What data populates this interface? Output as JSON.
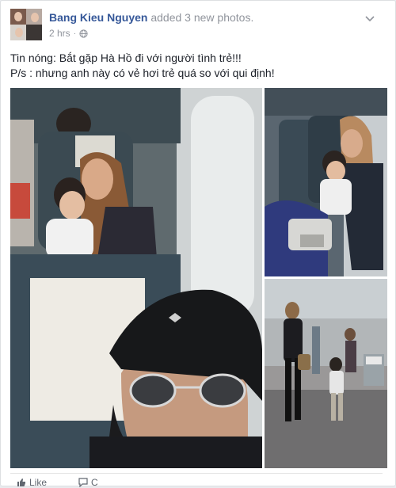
{
  "post": {
    "author": "Bang Kieu Nguyen",
    "action": "added 3 new photos.",
    "timestamp": "2 hrs",
    "separator": "·",
    "privacy_icon": "globe-icon",
    "menu_icon": "chevron-down-icon",
    "text_line1": "Tin nóng: Bắt gặp Hà Hồ đi với người tình trẻ!!!",
    "text_line2": "P/s : nhưng anh này có vẻ hơi trẻ quá so với qui định!"
  },
  "photos": [
    {
      "name": "photo-selfie-airplane"
    },
    {
      "name": "photo-woman-child-seat"
    },
    {
      "name": "photo-airport-walk"
    }
  ],
  "footer": {
    "like_label": "Like",
    "comment_label": "C"
  },
  "colors": {
    "link": "#365899",
    "muted": "#90949c",
    "text": "#1d2129"
  }
}
